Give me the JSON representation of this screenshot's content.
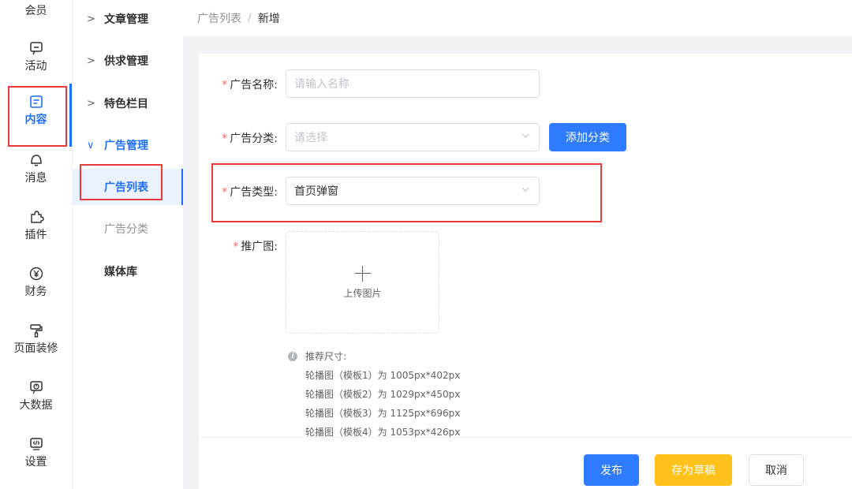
{
  "nav1": {
    "items": [
      {
        "label": "会员",
        "icon": "member-icon"
      },
      {
        "label": "活动",
        "icon": "activity-icon"
      },
      {
        "label": "内容",
        "icon": "content-icon"
      },
      {
        "label": "消息",
        "icon": "bell-icon"
      },
      {
        "label": "插件",
        "icon": "puzzle-icon"
      },
      {
        "label": "财务",
        "icon": "yuan-icon"
      },
      {
        "label": "页面装修",
        "icon": "paint-roller-icon"
      },
      {
        "label": "大数据",
        "icon": "chart-icon"
      },
      {
        "label": "设置",
        "icon": "code-icon"
      }
    ],
    "active": "内容"
  },
  "nav2": {
    "items": [
      {
        "label": "文章管理",
        "arrow": ">"
      },
      {
        "label": "供求管理",
        "arrow": ">"
      },
      {
        "label": "特色栏目",
        "arrow": ">"
      },
      {
        "label": "广告管理",
        "arrow": "∨"
      }
    ],
    "sub": [
      {
        "label": "广告列表"
      },
      {
        "label": "广告分类"
      }
    ],
    "plain": [
      {
        "label": "媒体库"
      }
    ]
  },
  "breadcrumb": {
    "parent": "广告列表",
    "separator": "/",
    "current": "新增"
  },
  "form": {
    "name": {
      "label": "广告名称:",
      "placeholder": "请输入名称"
    },
    "category": {
      "label": "广告分类:",
      "placeholder": "请选择",
      "add_button": "添加分类"
    },
    "type": {
      "label": "广告类型:",
      "value": "首页弹窗"
    },
    "image": {
      "label": "推广图:",
      "upload_label": "上传图片"
    },
    "tips": {
      "title": "推荐尺寸:",
      "lines": [
        "轮播图（模板1）为 1005px*402px",
        "轮播图（模板2）为 1029px*450px",
        "轮播图（模板3）为 1125px*696px",
        "轮播图（模板4）为 1053px*426px"
      ]
    },
    "required_mark": "*"
  },
  "footer": {
    "publish": "发布",
    "draft": "存为草稿",
    "cancel": "取消"
  },
  "colors": {
    "primary": "#2f7bff",
    "warning": "#ffc21a",
    "highlight": "#e83a3a"
  }
}
